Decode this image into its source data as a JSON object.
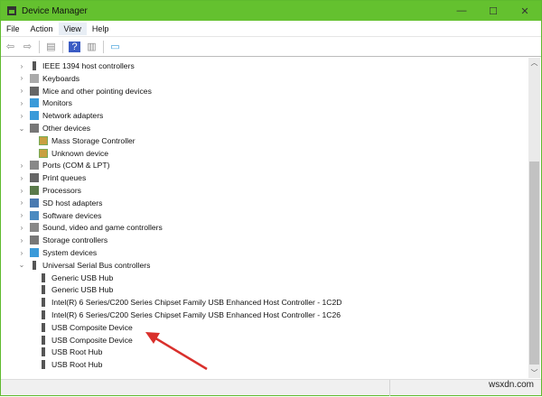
{
  "window": {
    "title": "Device Manager",
    "minimize": "—",
    "maximize": "☐",
    "close": "✕"
  },
  "menu": [
    "File",
    "Action",
    "View",
    "Help"
  ],
  "toolbar": [
    {
      "icon": "back-icon",
      "g": "⇦"
    },
    {
      "icon": "forward-icon",
      "g": "⇨"
    },
    {
      "icon": "show-hide-console-tree-icon",
      "g": "▤"
    },
    {
      "icon": "help-icon",
      "g": "?"
    },
    {
      "icon": "action-pane-icon",
      "g": "▥"
    },
    {
      "icon": "monitor-icon",
      "g": "▭"
    }
  ],
  "tree": [
    {
      "label": "IEEE 1394 host controllers",
      "level": 0,
      "expanded": false,
      "icon": "usb"
    },
    {
      "label": "Keyboards",
      "level": 0,
      "expanded": false,
      "icon": "keyboard"
    },
    {
      "label": "Mice and other pointing devices",
      "level": 0,
      "expanded": false,
      "icon": "mouse"
    },
    {
      "label": "Monitors",
      "level": 0,
      "expanded": false,
      "icon": "monitor"
    },
    {
      "label": "Network adapters",
      "level": 0,
      "expanded": false,
      "icon": "network"
    },
    {
      "label": "Other devices",
      "level": 0,
      "expanded": true,
      "icon": "other"
    },
    {
      "label": "Mass Storage Controller",
      "level": 1,
      "icon": "warn"
    },
    {
      "label": "Unknown device",
      "level": 1,
      "icon": "warn"
    },
    {
      "label": "Ports (COM & LPT)",
      "level": 0,
      "expanded": false,
      "icon": "port"
    },
    {
      "label": "Print queues",
      "level": 0,
      "expanded": false,
      "icon": "printer"
    },
    {
      "label": "Processors",
      "level": 0,
      "expanded": false,
      "icon": "cpu"
    },
    {
      "label": "SD host adapters",
      "level": 0,
      "expanded": false,
      "icon": "sd"
    },
    {
      "label": "Software devices",
      "level": 0,
      "expanded": false,
      "icon": "software"
    },
    {
      "label": "Sound, video and game controllers",
      "level": 0,
      "expanded": false,
      "icon": "sound"
    },
    {
      "label": "Storage controllers",
      "level": 0,
      "expanded": false,
      "icon": "storage"
    },
    {
      "label": "System devices",
      "level": 0,
      "expanded": false,
      "icon": "system"
    },
    {
      "label": "Universal Serial Bus controllers",
      "level": 0,
      "expanded": true,
      "icon": "usb"
    },
    {
      "label": "Generic USB Hub",
      "level": 1,
      "icon": "usb"
    },
    {
      "label": "Generic USB Hub",
      "level": 1,
      "icon": "usb"
    },
    {
      "label": "Intel(R) 6 Series/C200 Series Chipset Family USB Enhanced Host Controller - 1C2D",
      "level": 1,
      "icon": "usb"
    },
    {
      "label": "Intel(R) 6 Series/C200 Series Chipset Family USB Enhanced Host Controller - 1C26",
      "level": 1,
      "icon": "usb"
    },
    {
      "label": "USB Composite Device",
      "level": 1,
      "icon": "usb"
    },
    {
      "label": "USB Composite Device",
      "level": 1,
      "icon": "usb"
    },
    {
      "label": "USB Root Hub",
      "level": 1,
      "icon": "usb"
    },
    {
      "label": "USB Root Hub",
      "level": 1,
      "icon": "usb"
    }
  ],
  "watermark": "wsxdn.com",
  "colors": {
    "titlebar": "#64c12f",
    "annotation_arrow": "#d9302c"
  }
}
